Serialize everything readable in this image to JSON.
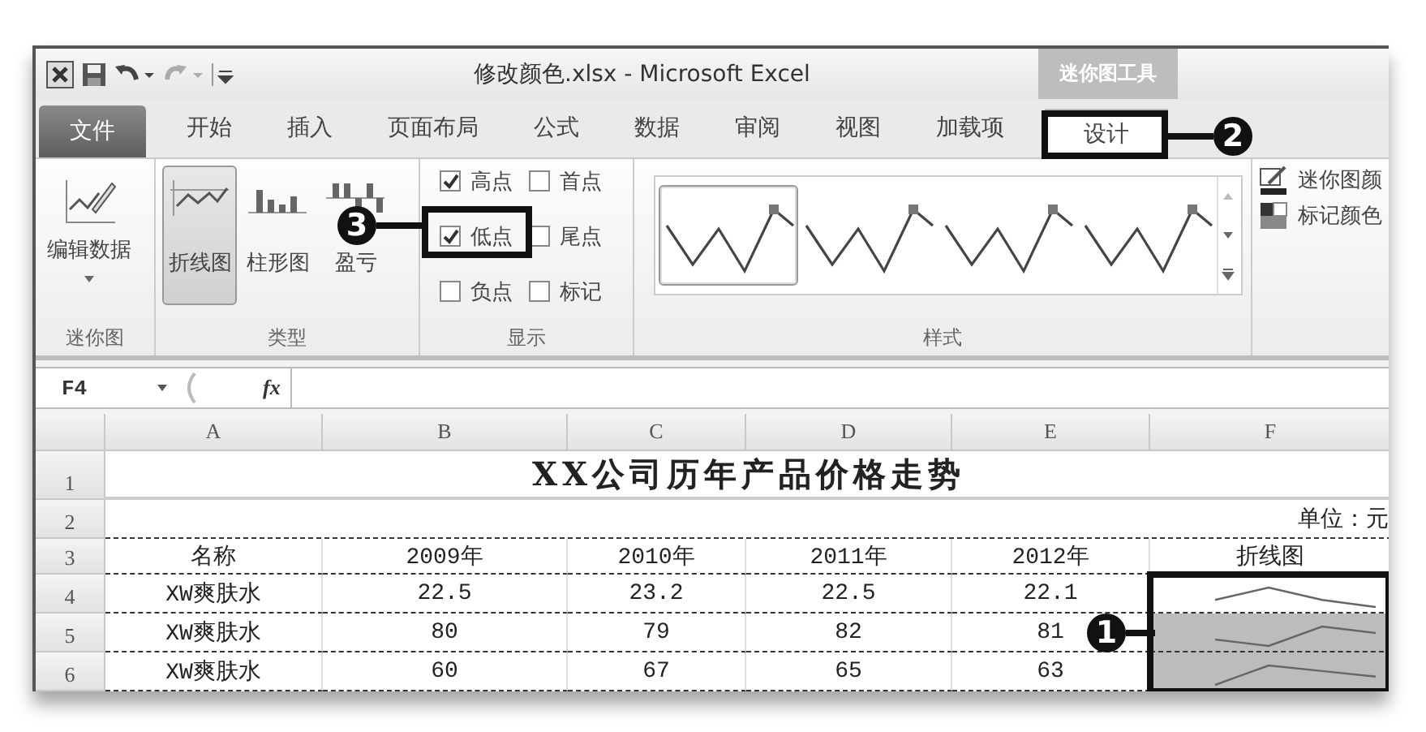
{
  "title_bar": {
    "title": "修改颜色.xlsx - Microsoft Excel",
    "contextual_title": "迷你图工具"
  },
  "ribbon_tabs": [
    {
      "label": "文件",
      "kind": "file",
      "selected": false
    },
    {
      "label": "开始",
      "kind": "normal",
      "selected": false
    },
    {
      "label": "插入",
      "kind": "normal",
      "selected": false
    },
    {
      "label": "页面布局",
      "kind": "normal",
      "selected": false
    },
    {
      "label": "公式",
      "kind": "normal",
      "selected": false
    },
    {
      "label": "数据",
      "kind": "normal",
      "selected": false
    },
    {
      "label": "审阅",
      "kind": "normal",
      "selected": false
    },
    {
      "label": "视图",
      "kind": "normal",
      "selected": false
    },
    {
      "label": "加载项",
      "kind": "normal",
      "selected": false
    },
    {
      "label": "设计",
      "kind": "contextual",
      "selected": true
    }
  ],
  "ribbon": {
    "sparkline_group": {
      "label": "迷你图",
      "edit_button": "编辑数据"
    },
    "type_group": {
      "label": "类型",
      "types": [
        {
          "label": "折线图",
          "kind": "line",
          "selected": true
        },
        {
          "label": "柱形图",
          "kind": "column",
          "selected": false
        },
        {
          "label": "盈亏",
          "kind": "winloss",
          "selected": false
        }
      ]
    },
    "show_group": {
      "label": "显示",
      "options": [
        {
          "label": "高点",
          "checked": true
        },
        {
          "label": "首点",
          "checked": false
        },
        {
          "label": "低点",
          "checked": true
        },
        {
          "label": "尾点",
          "checked": false
        },
        {
          "label": "负点",
          "checked": false
        },
        {
          "label": "标记",
          "checked": false
        }
      ]
    },
    "style_group": {
      "label": "样式",
      "styles": [
        {
          "selected": true
        },
        {
          "selected": false
        },
        {
          "selected": false
        },
        {
          "selected": false
        }
      ]
    },
    "color_buttons": [
      {
        "label": "迷你图颜",
        "kind": "sparkline_color"
      },
      {
        "label": "标记颜色",
        "kind": "marker_color"
      }
    ]
  },
  "formula_bar": {
    "name_box": "F4",
    "function_label": "fx"
  },
  "sheet": {
    "columns": [
      "A",
      "B",
      "C",
      "D",
      "E",
      "F"
    ],
    "rows": [
      {
        "header": "1",
        "title": "XX公司历年产品价格走势"
      },
      {
        "header": "2",
        "note": "单位：元"
      },
      {
        "header": "3",
        "cells": [
          "名称",
          "2009年",
          "2010年",
          "2011年",
          "2012年",
          "折线图"
        ]
      },
      {
        "header": "4",
        "cells": [
          "XW爽肤水",
          "22.5",
          "23.2",
          "22.5",
          "22.1"
        ],
        "sparkline": {
          "selected": false
        }
      },
      {
        "header": "5",
        "cells": [
          "XW爽肤水",
          "80",
          "79",
          "82",
          "81"
        ],
        "sparkline": {
          "selected": true
        }
      },
      {
        "header": "6",
        "cells": [
          "XW爽肤水",
          "60",
          "67",
          "65",
          "63"
        ],
        "sparkline": {
          "selected": true
        }
      }
    ]
  },
  "callouts": [
    {
      "number": "1"
    },
    {
      "number": "2"
    },
    {
      "number": "3"
    }
  ]
}
